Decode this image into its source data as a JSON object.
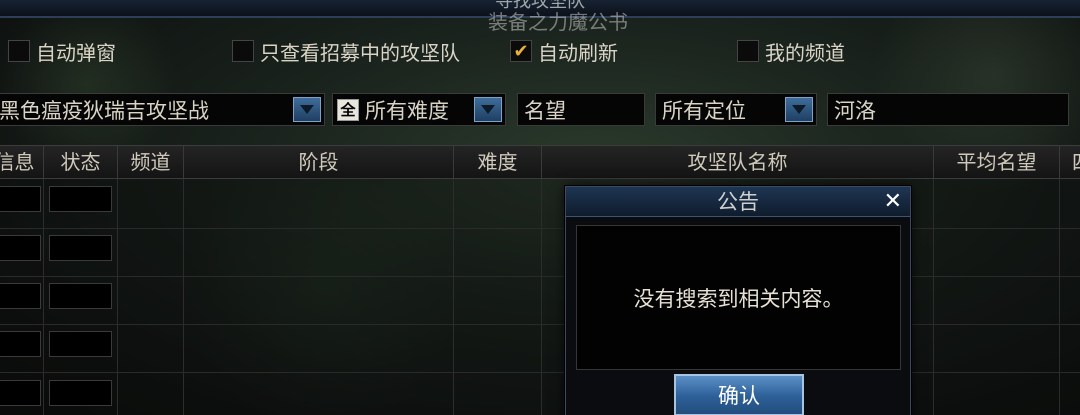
{
  "window": {
    "title": "寻找攻坚队",
    "ghost_text": "装备之力魔公书"
  },
  "options": {
    "auto_popup": {
      "label": "自动弹窗",
      "checked": false
    },
    "only_recruiting": {
      "label": "只查看招募中的攻坚队",
      "checked": false
    },
    "auto_refresh": {
      "label": "自动刷新",
      "checked": true
    },
    "my_channel": {
      "label": "我的频道",
      "checked": false
    }
  },
  "filters": {
    "raid": "黑色瘟疫狄瑞吉攻坚战",
    "difficulty_badge": "全",
    "difficulty": "所有难度",
    "fame_placeholder": "名望",
    "position": "所有定位",
    "search": "河洛"
  },
  "table": {
    "headers": [
      "信息",
      "状态",
      "频道",
      "阶段",
      "难度",
      "攻坚队名称",
      "平均名望",
      "四"
    ]
  },
  "dialog": {
    "title": "公告",
    "close_icon": "close-icon",
    "message": "没有搜索到相关内容。",
    "ok_label": "确认"
  }
}
